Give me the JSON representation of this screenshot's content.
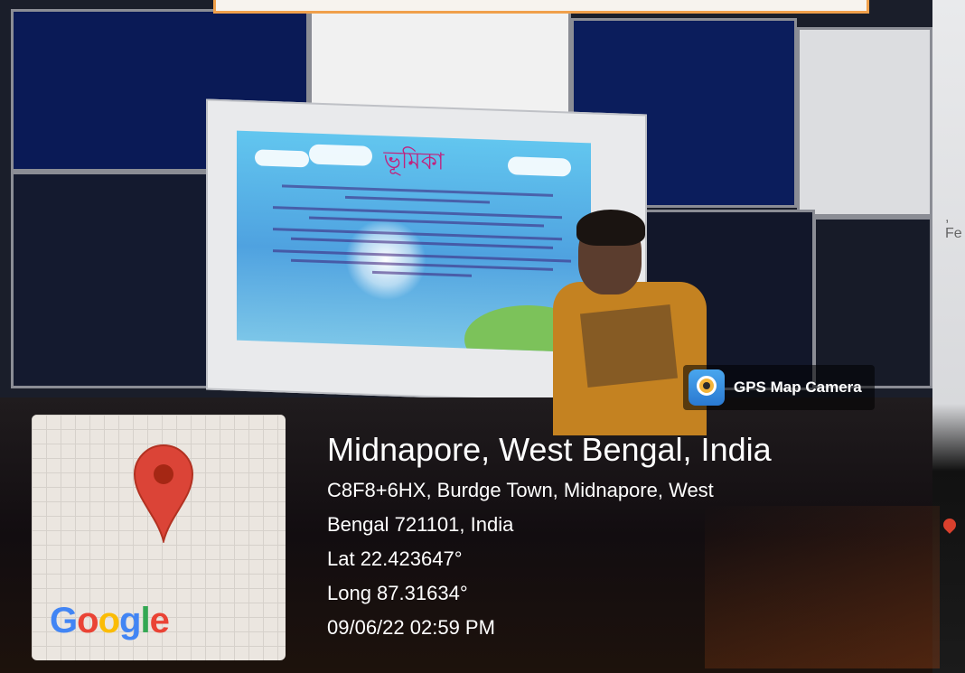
{
  "gps_overlay": {
    "app_name": "GPS Map Camera",
    "map_brand": "Google",
    "location_title": "Midnapore, West Bengal, India",
    "address_line1": "C8F8+6HX, Burdge Town, Midnapore, West",
    "address_line2": "Bengal 721101, India",
    "latitude": "Lat 22.423647°",
    "longitude": "Long 87.31634°",
    "datetime": "09/06/22 02:59 PM"
  },
  "slide": {
    "title": "ভূমিকা"
  },
  "colors": {
    "pin_red": "#db4437",
    "pin_dark": "#a52714",
    "google_blue": "#4285f4",
    "google_red": "#ea4335",
    "google_yellow": "#fbbc05",
    "google_green": "#34a853"
  },
  "icons": [
    "map-pin-icon",
    "gps-map-camera-icon"
  ]
}
